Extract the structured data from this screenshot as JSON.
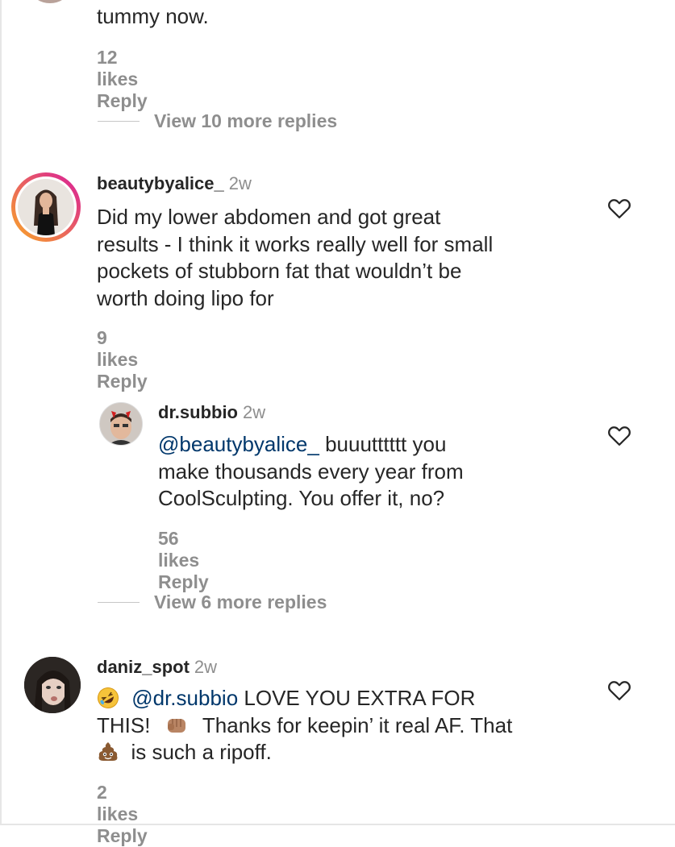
{
  "top": {
    "text_tail": "tummy now.",
    "likes": "12 likes",
    "reply": "Reply"
  },
  "view_more_1": "View 10 more replies",
  "comment1": {
    "username": "beautybyalice_",
    "time": "2w",
    "lines": [
      "Did my lower abdomen and got great",
      "results - I think it works really well for small",
      "pockets of stubborn fat that wouldn’t be",
      "worth doing lipo for"
    ],
    "likes": "9 likes",
    "reply": "Reply"
  },
  "reply1": {
    "username": "dr.subbio",
    "time": "2w",
    "mention": "@beautybyalice_",
    "line1_rest": " buuutttttt you",
    "line2": "make thousands every year from",
    "line3": "CoolSculpting. You offer it, no?",
    "likes": "56 likes",
    "reply": "Reply"
  },
  "view_more_2": "View 6 more replies",
  "comment2": {
    "username": "daniz_spot",
    "time": "2w",
    "mention": "@dr.subbio",
    "line1_rest": " LOVE YOU EXTRA FOR",
    "line2_a": "THIS! ",
    "line2_b": " Thanks for keepin’ it real AF. That",
    "line3_b": " is such a ripoff.",
    "likes": "2 likes",
    "reply": "Reply"
  },
  "icons": {
    "heart": "heart-icon",
    "laughing_emoji": "rolling-on-floor-laughing-emoji",
    "fist_emoji": "fist-bump-emoji",
    "poop_emoji": "pile-of-poo-emoji"
  },
  "colors": {
    "text": "#262626",
    "meta": "#8e8e8e",
    "mention": "#00376b",
    "story_ring_start": "#f9a825",
    "story_ring_end": "#d81b9c"
  }
}
